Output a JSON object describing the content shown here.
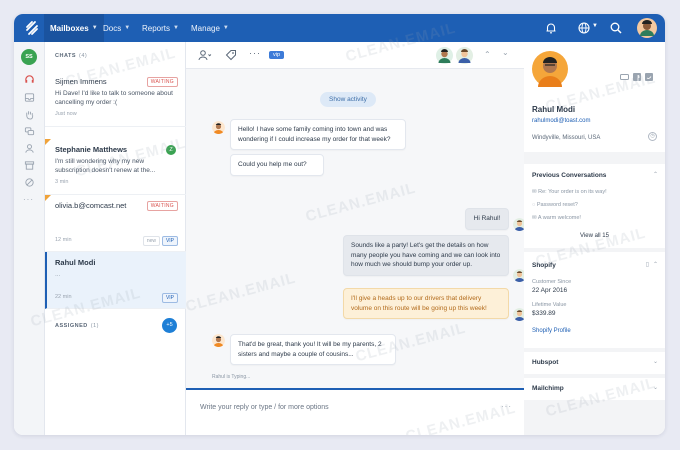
{
  "brand": {
    "accent": "#1e5fb4"
  },
  "topnav": {
    "items": [
      "Mailboxes",
      "Docs",
      "Reports",
      "Manage"
    ],
    "icons": [
      "bell-icon",
      "globe-icon",
      "search-icon",
      "user-avatar"
    ]
  },
  "rail": {
    "avatar_initials": "SS"
  },
  "chats": {
    "header": "CHATS",
    "count": "(4)",
    "items": [
      {
        "name": "Sijmen Immens",
        "text": "Hi Dave! I'd like to talk to someone about cancelling my order :(",
        "time": "Just now",
        "badge": "WAITING"
      },
      {
        "name": "Stephanie Matthews",
        "text": "I'm still wondering why my new subscription doesn't renew at the...",
        "time": "3 min",
        "assignee": "Z"
      },
      {
        "name": "olivia.b@comcast.net",
        "text": "",
        "time": "12 min",
        "badge": "WAITING",
        "tag": "new",
        "vip": "VIP"
      },
      {
        "name": "Rahul Modi",
        "text": "...",
        "time": "22 min",
        "vip": "VIP"
      }
    ],
    "assigned_label": "ASSIGNED",
    "assigned_count": "(1)",
    "assigned_badge": "+5"
  },
  "thread": {
    "tag": "vip",
    "show_activity": "Show activity",
    "messages": [
      {
        "from": "customer",
        "text": "Hello! I have some family coming into town and was wondering if I could increase my order for that week?"
      },
      {
        "from": "customer",
        "text": "Could you help me out?"
      },
      {
        "from": "agent",
        "text": "Hi Rahul!"
      },
      {
        "from": "agent",
        "text": "Sounds like a party! Let's get the details on how many people you have coming and we can look into how much we should bump your order up."
      },
      {
        "from": "note",
        "text": "I'll give a heads up to our drivers that delivery volume on this route will be going up this week!"
      },
      {
        "from": "customer",
        "text": "That'd be great, thank you!  It will be my parents, 2 sisters and maybe a couple of cousins..."
      }
    ],
    "typing": "Rahul is Typing...",
    "reply_placeholder": "Write your reply or type / for more options"
  },
  "profile": {
    "name": "Rahul Modi",
    "email": "rahulmodi@toast.com",
    "location": "Windyville, Missouri, USA",
    "prev_title": "Previous Conversations",
    "prev_items": [
      "Re: Your order is on its way!",
      "Password reset?",
      "A warm welcome!"
    ],
    "view_all": "View all 15",
    "shopify_title": "Shopify",
    "customer_since_label": "Customer Since",
    "customer_since": "22 Apr 2016",
    "lifetime_label": "Lifetime Value",
    "lifetime": "$339.89",
    "shopify_link": "Shopify Profile",
    "hubspot": "Hubspot",
    "mailchimp": "Mailchimp"
  },
  "watermark": "CLEAN.EMAIL"
}
